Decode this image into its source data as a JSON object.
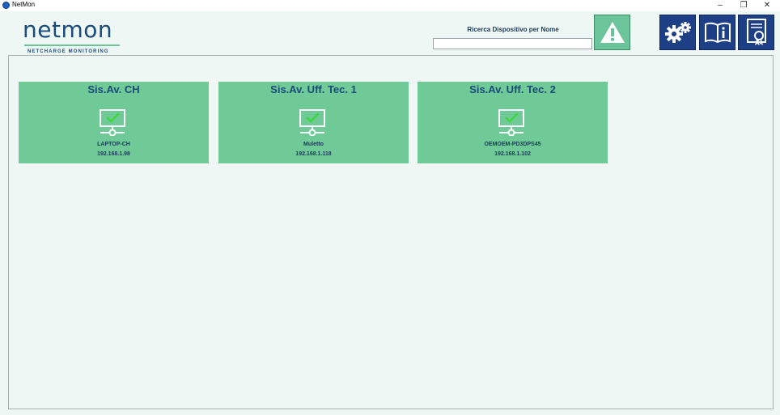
{
  "window": {
    "title": "NetMon",
    "minimize_glyph": "–",
    "restore_glyph": "❐",
    "close_glyph": "✕"
  },
  "logo": {
    "name": "netmon",
    "tagline": "NETCHARGE MONITORING"
  },
  "search": {
    "label": "Ricerca Dispositivo per Nome",
    "value": ""
  },
  "toolbar": {
    "alert_icon": "warning-icon",
    "settings_icon": "gears-icon",
    "manual_icon": "book-info-icon",
    "license_icon": "certificate-icon"
  },
  "devices": [
    {
      "title": "Sis.Av. CH",
      "hostname": "LAPTOP-CH",
      "ip": "192.168.1.98",
      "status": "ok"
    },
    {
      "title": "Sis.Av. Uff. Tec. 1",
      "hostname": "Muletto",
      "ip": "192.168.1.118",
      "status": "ok"
    },
    {
      "title": "Sis.Av. Uff. Tec. 2",
      "hostname": "OEMOEM-PD3DPS45",
      "ip": "192.168.1.102",
      "status": "ok"
    }
  ],
  "colors": {
    "brand_navy": "#1d3f86",
    "accent_green": "#6fca97",
    "status_ok": "#3cd63c"
  }
}
